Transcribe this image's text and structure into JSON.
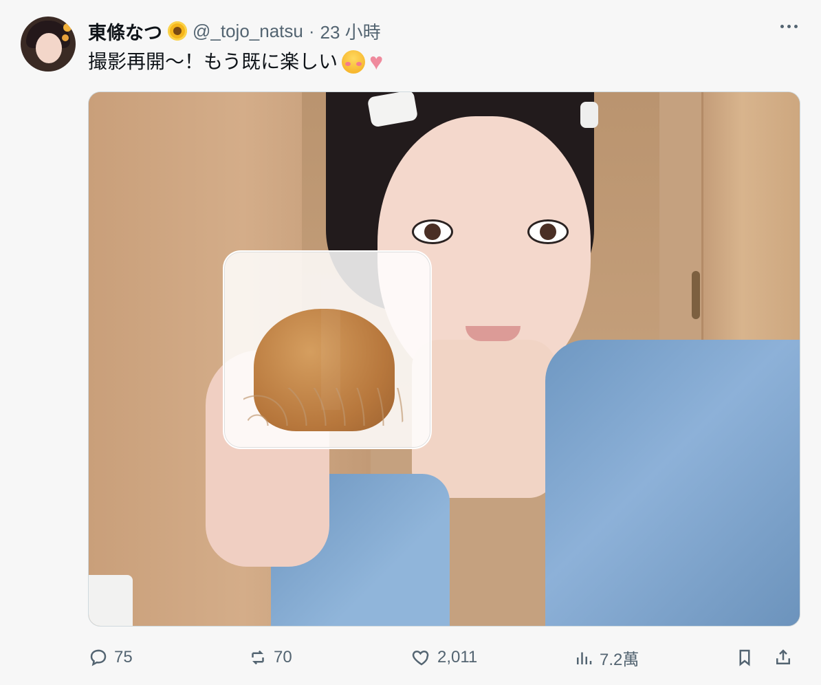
{
  "post": {
    "author_name": "東條なつ",
    "author_handle": "@_tojo_natsu",
    "separator": "·",
    "time": "23 小時",
    "text": "撮影再開〜！もう既に楽しい",
    "emoji": "☺️",
    "heart": "♥",
    "icons": {
      "sunflower": "sunflower-icon",
      "more": "more-horizontal-icon",
      "reply": "reply-icon",
      "retweet": "retweet-icon",
      "like": "heart-icon",
      "views": "views-icon",
      "bookmark": "bookmark-icon",
      "share": "share-icon"
    }
  },
  "metrics": {
    "replies": "75",
    "retweets": "70",
    "likes": "2,011",
    "views": "7.2萬"
  }
}
